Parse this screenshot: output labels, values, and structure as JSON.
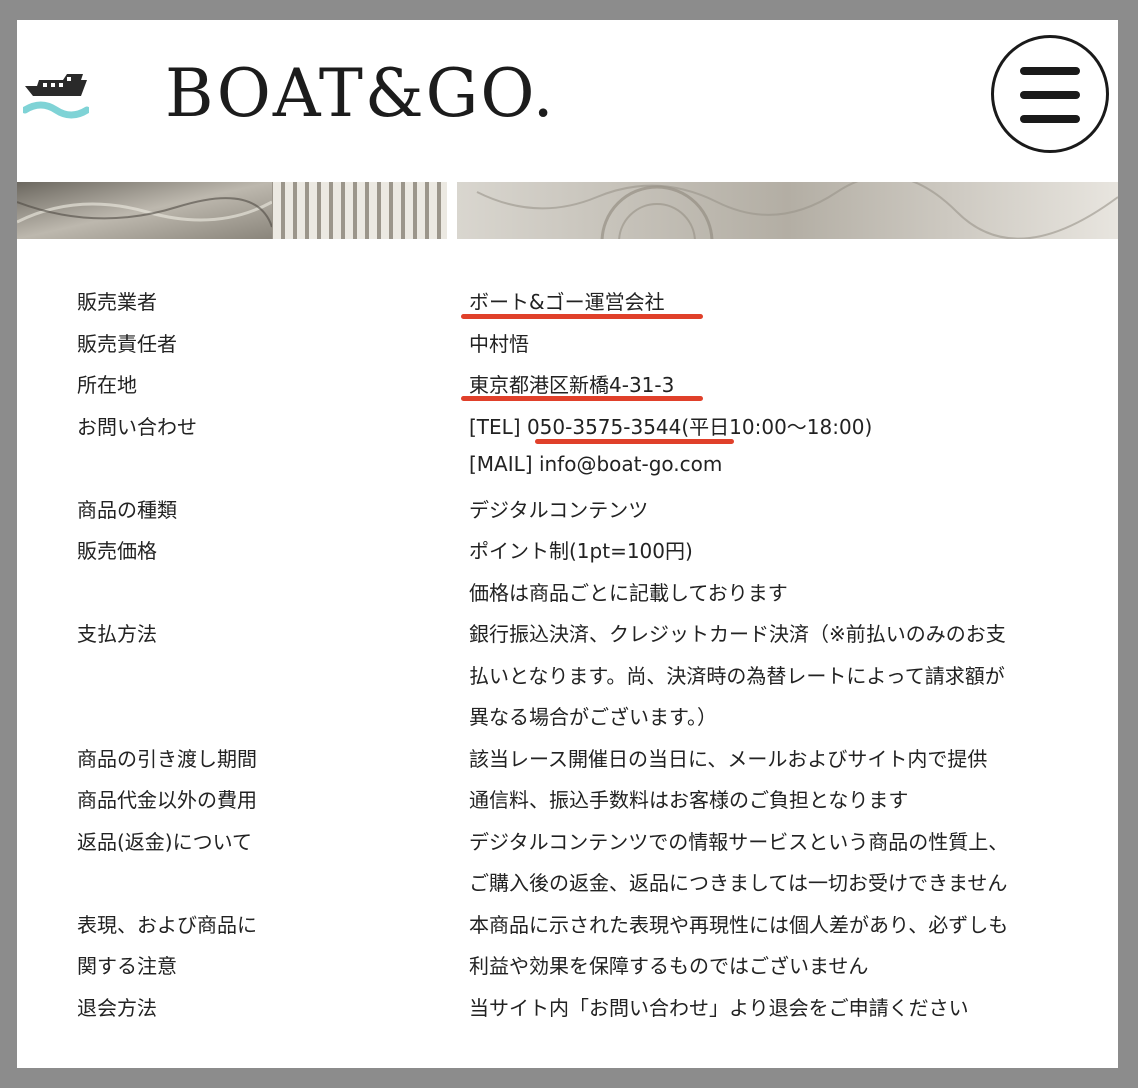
{
  "header": {
    "brand": "BOAT&GO.",
    "logo_icon": "boat-wave-icon",
    "menu_icon": "hamburger-menu-icon"
  },
  "colors": {
    "annotation_underline": "#e0402a",
    "logo_wave": "#7fd3d6",
    "text": "#222222"
  },
  "table": {
    "rows": [
      {
        "label": "販売業者",
        "value": "ボート&ゴー運営会社"
      },
      {
        "label": "販売責任者",
        "value": "中村悟"
      },
      {
        "label": "所在地",
        "value": "東京都港区新橋4-31-3"
      },
      {
        "label": "お問い合わせ",
        "value": "[TEL] 050-3575-3544(平日10:00〜18:00)"
      },
      {
        "label": "",
        "value": "[MAIL] info@boat-go.com"
      },
      {
        "label": "商品の種類",
        "value": "デジタルコンテンツ"
      },
      {
        "label": "販売価格",
        "value": "ポイント制(1pt=100円)"
      },
      {
        "label": "",
        "value": "価格は商品ごとに記載しております"
      },
      {
        "label": "支払方法",
        "value": "銀行振込決済、クレジットカード決済（※前払いのみのお支"
      },
      {
        "label": "",
        "value": "払いとなります。尚、決済時の為替レートによって請求額が"
      },
      {
        "label": "",
        "value": "異なる場合がございます。）"
      },
      {
        "label": "商品の引き渡し期間",
        "value": "該当レース開催日の当日に、メールおよびサイト内で提供"
      },
      {
        "label": "商品代金以外の費用",
        "value": "通信料、振込手数料はお客様のご負担となります"
      },
      {
        "label": "返品(返金)について",
        "value": "デジタルコンテンツでの情報サービスという商品の性質上、"
      },
      {
        "label": "",
        "value": "ご購入後の返金、返品につきましては一切お受けできません"
      },
      {
        "label": "表現、および商品に",
        "value": "本商品に示された表現や再現性には個人差があり、必ずしも"
      },
      {
        "label": "関する注意",
        "value": "利益や効果を保障するものではございません"
      },
      {
        "label": "退会方法",
        "value": "当サイト内「お問い合わせ」より退会をご申請ください"
      }
    ]
  }
}
